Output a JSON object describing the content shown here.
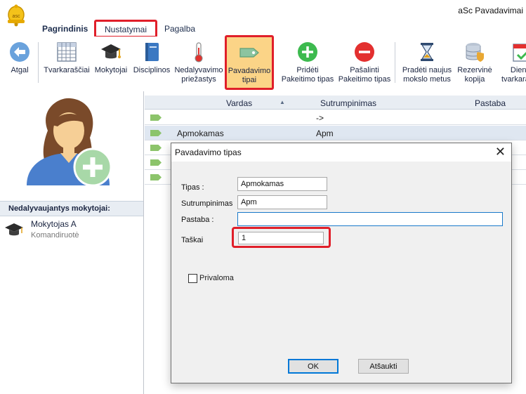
{
  "app": {
    "title": "aSc Pavadavimai"
  },
  "menu": {
    "tabs": [
      "Pagrindinis",
      "Nustatymai",
      "Pagalba"
    ]
  },
  "ribbon": {
    "back": "Atgal",
    "timetables": "Tvarkaraščiai",
    "teachers": "Mokytojai",
    "subjects": "Disciplinos",
    "absence_reasons": "Nedalyvavimo priežastys",
    "substitution_types": "Pavadavimo tipai",
    "add_type": "Pridėti Pakeitimo tipas",
    "remove_type": "Pašalinti Pakeitimo tipas",
    "new_year": "Pradėti naujus mokslo metus",
    "backup": "Rezervinė kopija",
    "diary": "Dienos tvarkaraščiai"
  },
  "left_panel": {
    "absent_header": "Nedalyvaujantys mokytojai:",
    "absent_teachers": [
      {
        "name": "Mokytojas A",
        "reason": "Komandiruotė"
      }
    ]
  },
  "grid": {
    "columns": [
      "Vardas",
      "Sutrumpinimas",
      "Pastaba"
    ],
    "rows": [
      {
        "name": "",
        "abbr": "->"
      },
      {
        "name": "Apmokamas",
        "abbr": "Apm"
      },
      {
        "name": "",
        "abbr": ""
      },
      {
        "name": "",
        "abbr": ""
      },
      {
        "name": "",
        "abbr": ""
      }
    ]
  },
  "dialog": {
    "title": "Pavadavimo tipas",
    "type_label": "Tipas :",
    "type_value": "Apmokamas",
    "abbr_label": "Sutrumpinimas",
    "abbr_value": "Apm",
    "note_label": "Pastaba :",
    "note_value": "",
    "points_label": "Taškai",
    "points_value": "1",
    "mandatory_label": "Privaloma",
    "mandatory_checked": false,
    "ok": "OK",
    "cancel": "Atšaukti"
  },
  "colors": {
    "highlight": "#e01f2a",
    "ribbon_selected": "#fbd487",
    "tag_green": "#8cc46b"
  }
}
